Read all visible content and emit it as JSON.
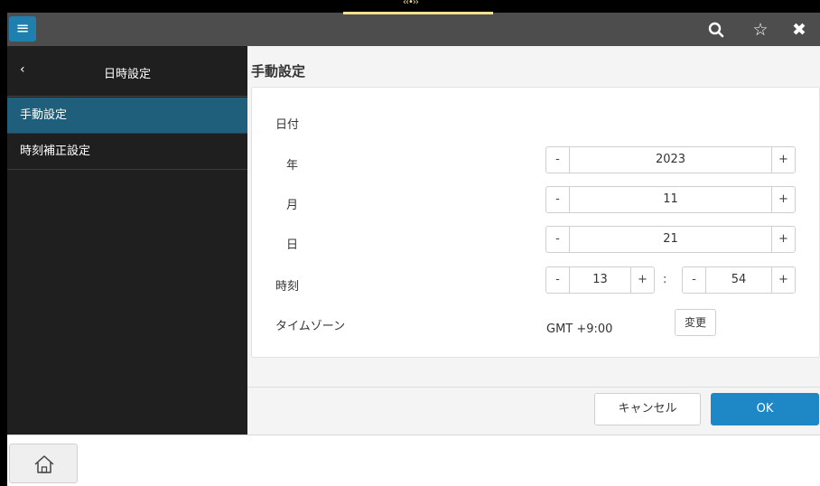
{
  "topbar": {
    "menu_icon": "hamburger-menu-icon",
    "icons": [
      "search-icon",
      "star-icon",
      "close-icon"
    ],
    "handle_glyph": "‹‹•››"
  },
  "sidebar": {
    "back_glyph": "‹",
    "title": "日時設定",
    "items": [
      {
        "label": "手動設定",
        "active": true
      },
      {
        "label": "時刻補正設定",
        "active": false
      }
    ]
  },
  "main": {
    "title": "手動設定",
    "date_section_label": "日付",
    "year": {
      "label": "年",
      "value": "2023"
    },
    "month": {
      "label": "月",
      "value": "11"
    },
    "day": {
      "label": "日",
      "value": "21"
    },
    "time": {
      "label": "時刻",
      "hour": "13",
      "minute": "54",
      "separator": ":"
    },
    "timezone": {
      "label": "タイムゾーン",
      "value": "GMT +9:00",
      "change_label": "変更"
    },
    "minus_glyph": "-",
    "plus_glyph": "+"
  },
  "footer": {
    "cancel_label": "キャンセル",
    "ok_label": "OK"
  },
  "bottombar": {
    "home_icon": "home-icon"
  },
  "colors": {
    "accent": "#1e88c7",
    "sidebar_active": "#1f5f7c",
    "topbar": "#4d4d4d",
    "sidebar_bg": "#1f1f1f"
  }
}
